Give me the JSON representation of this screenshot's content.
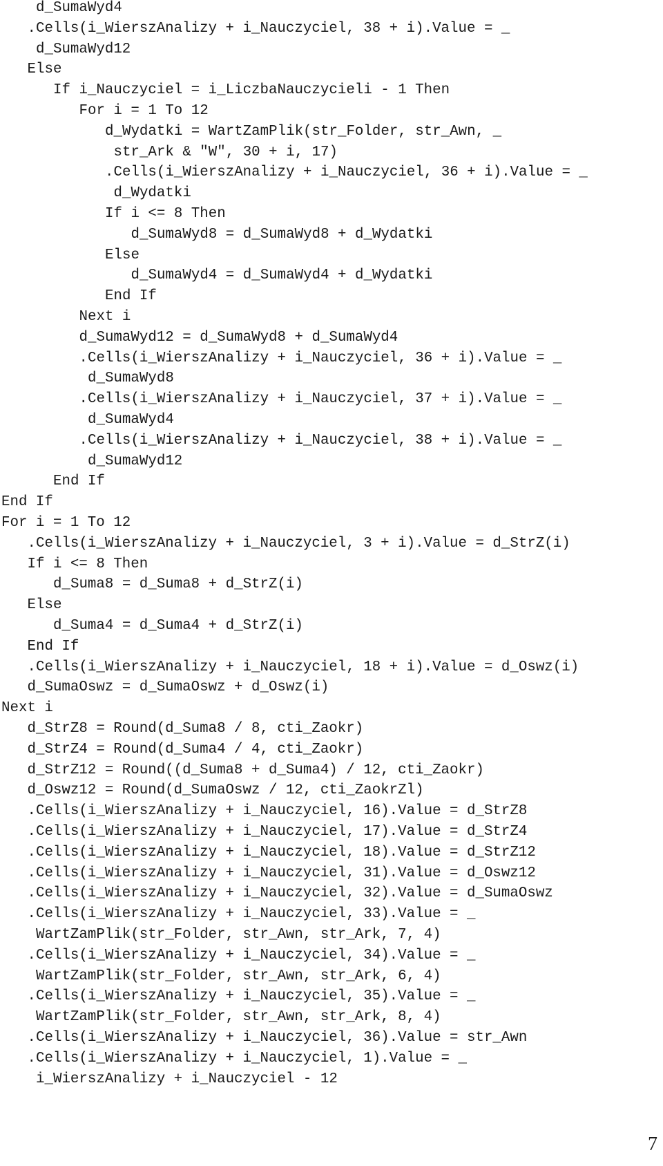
{
  "code_lines": [
    {
      "indent": 4,
      "text": "d_SumaWyd4"
    },
    {
      "indent": 3,
      "text": ".Cells(i_WierszAnalizy + i_Nauczyciel, 38 + i).Value = _"
    },
    {
      "indent": 4,
      "text": "d_SumaWyd12"
    },
    {
      "indent": 3,
      "text": "Else"
    },
    {
      "indent": 6,
      "text": "If i_Nauczyciel = i_LiczbaNauczycieli - 1 Then"
    },
    {
      "indent": 9,
      "text": "For i = 1 To 12"
    },
    {
      "indent": 12,
      "text": "d_Wydatki = WartZamPlik(str_Folder, str_Awn, _"
    },
    {
      "indent": 13,
      "text": "str_Ark & \"W\", 30 + i, 17)"
    },
    {
      "indent": 12,
      "text": ".Cells(i_WierszAnalizy + i_Nauczyciel, 36 + i).Value = _"
    },
    {
      "indent": 13,
      "text": "d_Wydatki"
    },
    {
      "indent": 12,
      "text": "If i <= 8 Then"
    },
    {
      "indent": 15,
      "text": "d_SumaWyd8 = d_SumaWyd8 + d_Wydatki"
    },
    {
      "indent": 12,
      "text": "Else"
    },
    {
      "indent": 15,
      "text": "d_SumaWyd4 = d_SumaWyd4 + d_Wydatki"
    },
    {
      "indent": 12,
      "text": "End If"
    },
    {
      "indent": 9,
      "text": "Next i"
    },
    {
      "indent": 9,
      "text": "d_SumaWyd12 = d_SumaWyd8 + d_SumaWyd4"
    },
    {
      "indent": 9,
      "text": ".Cells(i_WierszAnalizy + i_Nauczyciel, 36 + i).Value = _"
    },
    {
      "indent": 10,
      "text": "d_SumaWyd8"
    },
    {
      "indent": 9,
      "text": ".Cells(i_WierszAnalizy + i_Nauczyciel, 37 + i).Value = _"
    },
    {
      "indent": 10,
      "text": "d_SumaWyd4"
    },
    {
      "indent": 9,
      "text": ".Cells(i_WierszAnalizy + i_Nauczyciel, 38 + i).Value = _"
    },
    {
      "indent": 10,
      "text": "d_SumaWyd12"
    },
    {
      "indent": 6,
      "text": "End If"
    },
    {
      "indent": 0,
      "text": "End If"
    },
    {
      "indent": 0,
      "text": "For i = 1 To 12"
    },
    {
      "indent": 3,
      "text": ".Cells(i_WierszAnalizy + i_Nauczyciel, 3 + i).Value = d_StrZ(i)"
    },
    {
      "indent": 3,
      "text": "If i <= 8 Then"
    },
    {
      "indent": 6,
      "text": "d_Suma8 = d_Suma8 + d_StrZ(i)"
    },
    {
      "indent": 3,
      "text": "Else"
    },
    {
      "indent": 6,
      "text": "d_Suma4 = d_Suma4 + d_StrZ(i)"
    },
    {
      "indent": 3,
      "text": "End If"
    },
    {
      "indent": 3,
      "text": ".Cells(i_WierszAnalizy + i_Nauczyciel, 18 + i).Value = d_Oswz(i)"
    },
    {
      "indent": 3,
      "text": "d_SumaOswz = d_SumaOswz + d_Oswz(i)"
    },
    {
      "indent": 0,
      "text": "Next i"
    },
    {
      "indent": 3,
      "text": "d_StrZ8 = Round(d_Suma8 / 8, cti_Zaokr)"
    },
    {
      "indent": 3,
      "text": "d_StrZ4 = Round(d_Suma4 / 4, cti_Zaokr)"
    },
    {
      "indent": 3,
      "text": "d_StrZ12 = Round((d_Suma8 + d_Suma4) / 12, cti_Zaokr)"
    },
    {
      "indent": 3,
      "text": "d_Oswz12 = Round(d_SumaOswz / 12, cti_ZaokrZl)"
    },
    {
      "indent": 3,
      "text": ".Cells(i_WierszAnalizy + i_Nauczyciel, 16).Value = d_StrZ8"
    },
    {
      "indent": 3,
      "text": ".Cells(i_WierszAnalizy + i_Nauczyciel, 17).Value = d_StrZ4"
    },
    {
      "indent": 3,
      "text": ".Cells(i_WierszAnalizy + i_Nauczyciel, 18).Value = d_StrZ12"
    },
    {
      "indent": 3,
      "text": ".Cells(i_WierszAnalizy + i_Nauczyciel, 31).Value = d_Oswz12"
    },
    {
      "indent": 3,
      "text": ".Cells(i_WierszAnalizy + i_Nauczyciel, 32).Value = d_SumaOswz"
    },
    {
      "indent": 3,
      "text": ".Cells(i_WierszAnalizy + i_Nauczyciel, 33).Value = _"
    },
    {
      "indent": 4,
      "text": "WartZamPlik(str_Folder, str_Awn, str_Ark, 7, 4)"
    },
    {
      "indent": 3,
      "text": ".Cells(i_WierszAnalizy + i_Nauczyciel, 34).Value = _"
    },
    {
      "indent": 4,
      "text": "WartZamPlik(str_Folder, str_Awn, str_Ark, 6, 4)"
    },
    {
      "indent": 3,
      "text": ".Cells(i_WierszAnalizy + i_Nauczyciel, 35).Value = _"
    },
    {
      "indent": 4,
      "text": "WartZamPlik(str_Folder, str_Awn, str_Ark, 8, 4)"
    },
    {
      "indent": 3,
      "text": ".Cells(i_WierszAnalizy + i_Nauczyciel, 36).Value = str_Awn"
    },
    {
      "indent": 3,
      "text": ".Cells(i_WierszAnalizy + i_Nauczyciel, 1).Value = _"
    },
    {
      "indent": 4,
      "text": "i_WierszAnalizy + i_Nauczyciel - 12"
    }
  ],
  "page_number": "7"
}
